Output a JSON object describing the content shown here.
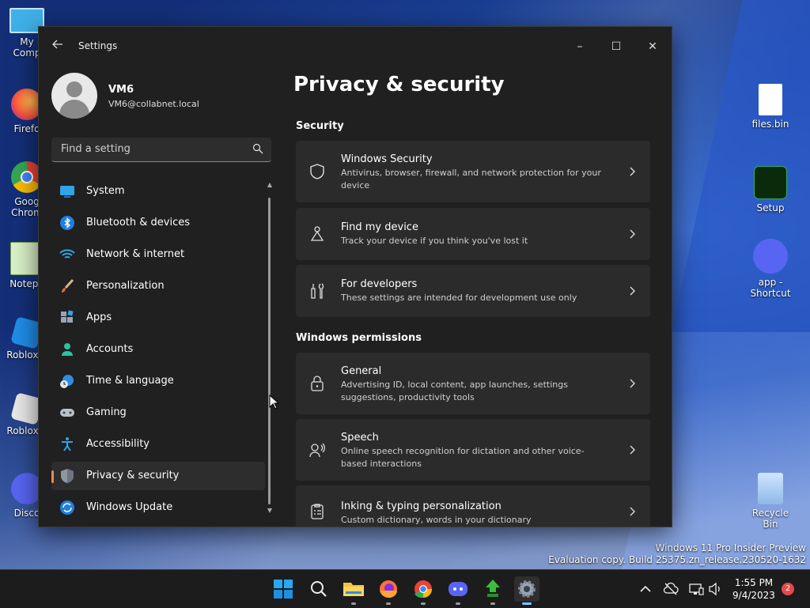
{
  "desktop": {
    "left_icons": [
      {
        "label": "My Comp",
        "icon": "computer-icon"
      },
      {
        "label": "Firefo",
        "icon": "firefox-icon"
      },
      {
        "label": "Goog Chrom",
        "icon": "chrome-icon"
      },
      {
        "label": "Notepa",
        "icon": "notepad-icon"
      },
      {
        "label": "Roblox S",
        "icon": "roblox-studio-icon"
      },
      {
        "label": "Roblox P",
        "icon": "roblox-player-icon"
      },
      {
        "label": "Disco",
        "icon": "discord-icon"
      }
    ],
    "right_icons": [
      {
        "label": "files.bin",
        "icon": "file-icon"
      },
      {
        "label": "Setup",
        "icon": "setup-icon"
      },
      {
        "label": "app - Shortcut",
        "icon": "discord-icon"
      },
      {
        "label": "Recycle Bin",
        "icon": "recycle-bin-icon"
      }
    ],
    "watermark_line1": "Windows 11 Pro Insider Preview",
    "watermark_line2": "Evaluation copy. Build 25375.zn_release.230520-1632"
  },
  "window": {
    "title": "Settings",
    "back_icon": "back-arrow-icon",
    "controls": {
      "minimize": "–",
      "maximize": "☐",
      "close": "✕"
    }
  },
  "user": {
    "name": "VM6",
    "email": "VM6@collabnet.local"
  },
  "search": {
    "placeholder": "Find a setting",
    "value": ""
  },
  "nav": {
    "items": [
      {
        "label": "System",
        "icon": "system-display-icon",
        "active": false
      },
      {
        "label": "Bluetooth & devices",
        "icon": "bluetooth-icon",
        "active": false
      },
      {
        "label": "Network & internet",
        "icon": "wifi-icon",
        "active": false
      },
      {
        "label": "Personalization",
        "icon": "brush-icon",
        "active": false
      },
      {
        "label": "Apps",
        "icon": "apps-icon",
        "active": false
      },
      {
        "label": "Accounts",
        "icon": "account-icon",
        "active": false
      },
      {
        "label": "Time & language",
        "icon": "globe-clock-icon",
        "active": false
      },
      {
        "label": "Gaming",
        "icon": "gamepad-icon",
        "active": false
      },
      {
        "label": "Accessibility",
        "icon": "accessibility-icon",
        "active": false
      },
      {
        "label": "Privacy & security",
        "icon": "shield-icon",
        "active": true
      },
      {
        "label": "Windows Update",
        "icon": "update-icon",
        "active": false
      }
    ],
    "accent_color": "#e88a5a"
  },
  "main": {
    "title": "Privacy & security",
    "sections": [
      {
        "heading": "Security",
        "cards": [
          {
            "title": "Windows Security",
            "desc": "Antivirus, browser, firewall, and network protection for your device",
            "icon": "shield-outline-icon"
          },
          {
            "title": "Find my device",
            "desc": "Track your device if you think you've lost it",
            "icon": "find-device-icon"
          },
          {
            "title": "For developers",
            "desc": "These settings are intended for development use only",
            "icon": "developer-tools-icon"
          }
        ]
      },
      {
        "heading": "Windows permissions",
        "cards": [
          {
            "title": "General",
            "desc": "Advertising ID, local content, app launches, settings suggestions, productivity tools",
            "icon": "lock-icon"
          },
          {
            "title": "Speech",
            "desc": "Online speech recognition for dictation and other voice-based interactions",
            "icon": "speech-icon"
          },
          {
            "title": "Inking & typing personalization",
            "desc": "Custom dictionary, words in your dictionary",
            "icon": "clipboard-list-icon"
          }
        ]
      }
    ]
  },
  "taskbar": {
    "apps": [
      {
        "name": "start",
        "icon": "windows-start-icon"
      },
      {
        "name": "search",
        "icon": "search-icon"
      },
      {
        "name": "file-explorer",
        "icon": "folder-icon"
      },
      {
        "name": "firefox",
        "icon": "firefox-icon"
      },
      {
        "name": "chrome",
        "icon": "chrome-icon"
      },
      {
        "name": "discord",
        "icon": "discord-icon"
      },
      {
        "name": "app",
        "icon": "green-arrow-app-icon"
      },
      {
        "name": "settings",
        "icon": "gear-icon",
        "active": true
      }
    ],
    "tray": [
      "chevron-up-icon",
      "cloud-offline-icon",
      "network-icon",
      "volume-icon"
    ],
    "time": "1:55 PM",
    "date": "9/4/2023",
    "notification_count": "2"
  }
}
